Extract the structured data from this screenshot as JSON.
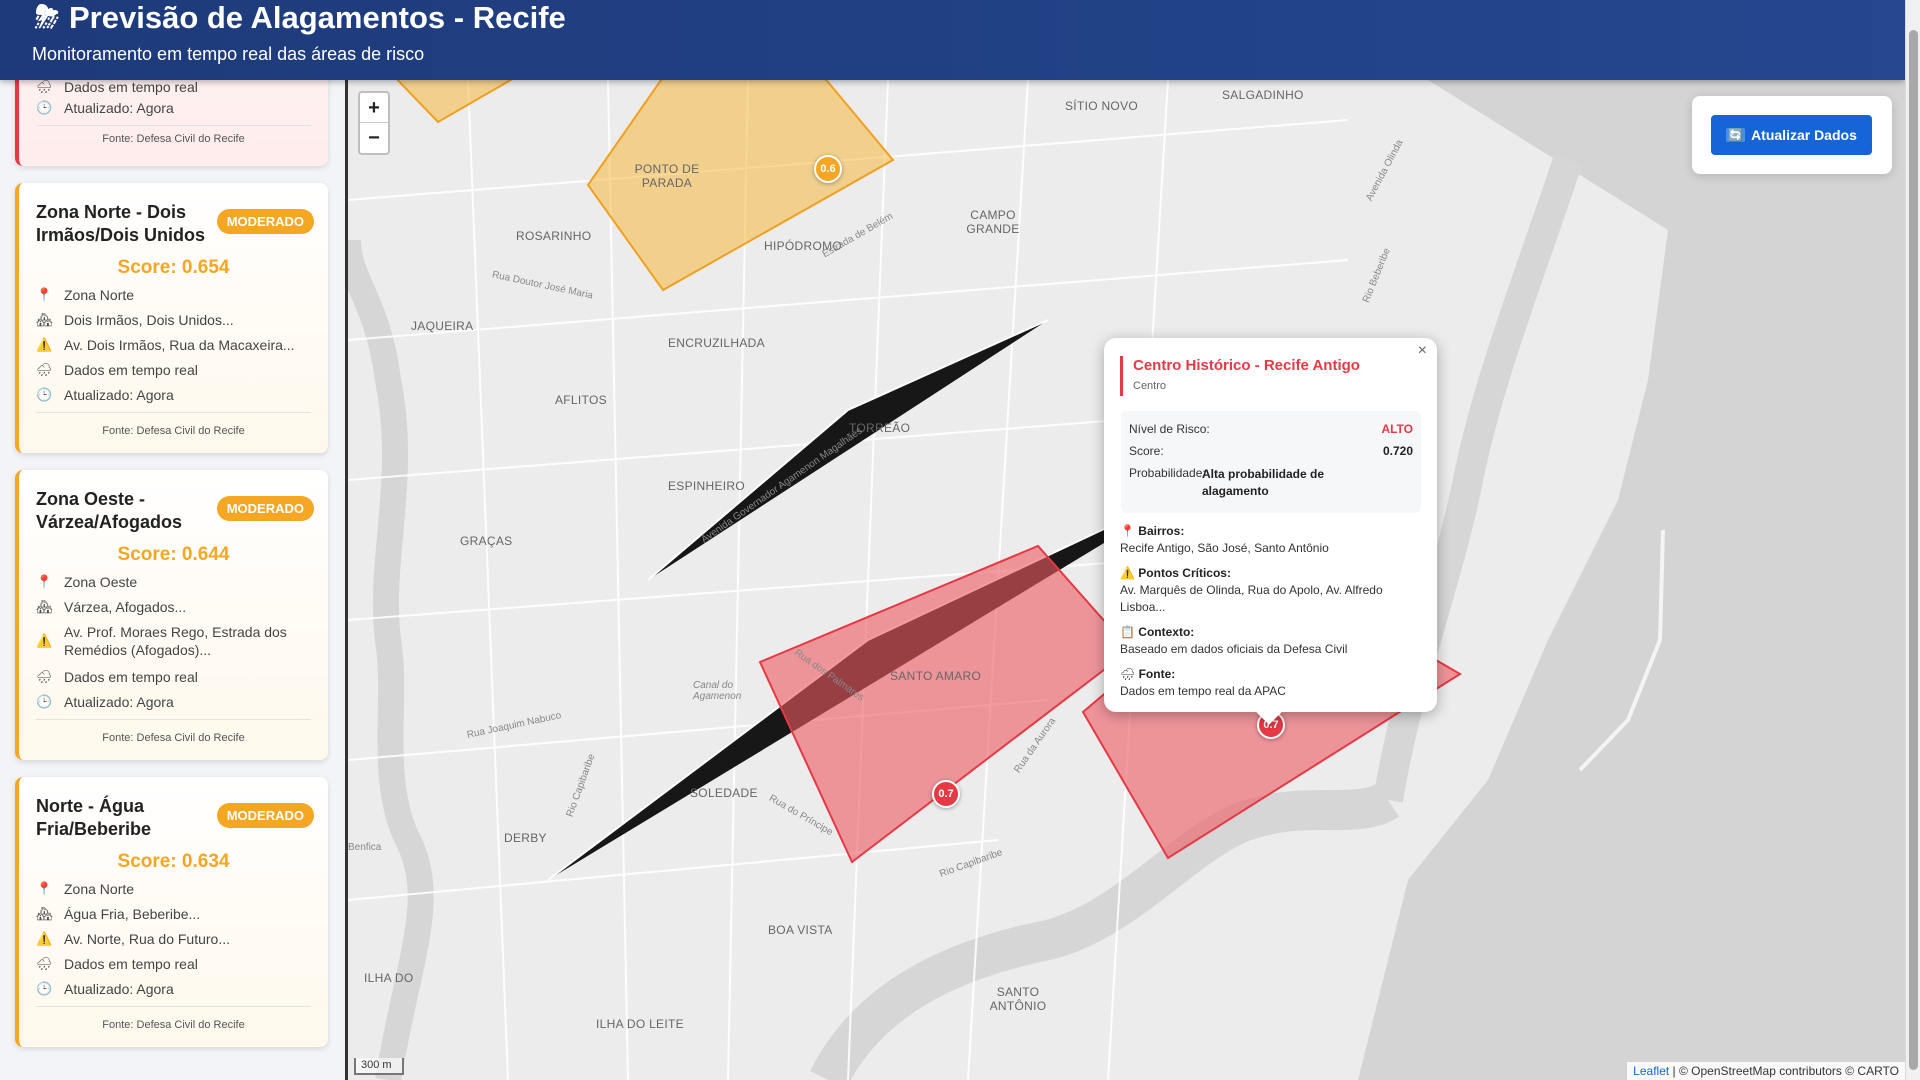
{
  "header": {
    "title": "Previsão de Alagamentos - Recife",
    "subtitle": "Monitoramento em tempo real das áreas de risco"
  },
  "sidebar": {
    "first_card_partial": {
      "data_label": "Dados em tempo real",
      "updated_label": "Atualizado: Agora",
      "source": "Fonte: Defesa Civil do Recife"
    },
    "cards": [
      {
        "name": "Zona Norte - Dois Irmãos/Dois Unidos",
        "badge": "MODERADO",
        "score": "Score: 0.654",
        "zone": "Zona Norte",
        "neighborhoods": "Dois Irmãos, Dois Unidos...",
        "critical": "Av. Dois Irmãos, Rua da Macaxeira...",
        "data_label": "Dados em tempo real",
        "updated_label": "Atualizado: Agora",
        "source": "Fonte: Defesa Civil do Recife"
      },
      {
        "name": "Zona Oeste - Várzea/Afogados",
        "badge": "MODERADO",
        "score": "Score: 0.644",
        "zone": "Zona Oeste",
        "neighborhoods": "Várzea, Afogados...",
        "critical": "Av. Prof. Moraes Rego, Estrada dos Remédios (Afogados)...",
        "data_label": "Dados em tempo real",
        "updated_label": "Atualizado: Agora",
        "source": "Fonte: Defesa Civil do Recife"
      },
      {
        "name": "Norte - Água Fria/Beberibe",
        "badge": "MODERADO",
        "score": "Score: 0.634",
        "zone": "Zona Norte",
        "neighborhoods": "Água Fria, Beberibe...",
        "critical": "Av. Norte, Rua do Futuro...",
        "data_label": "Dados em tempo real",
        "updated_label": "Atualizado: Agora",
        "source": "Fonte: Defesa Civil do Recife"
      }
    ]
  },
  "map": {
    "zoom_in": "+",
    "zoom_out": "−",
    "refresh_label": "Atualizar Dados",
    "markers": [
      "0.6",
      "0.7",
      "0.7"
    ],
    "places": {
      "salgadinho": "SALGADINHO",
      "sitio_novo": "SÍTIO NOVO",
      "ponto_de_parada": "PONTO DE PARADA",
      "campo_grande": "CAMPO GRANDE",
      "rosarinho": "ROSARINHO",
      "hipodromo": "HIPÓDROMO",
      "jaqueira": "JAQUEIRA",
      "encruzilhada": "ENCRUZILHADA",
      "aflitos": "AFLITOS",
      "torreao": "TORREÃO",
      "espinheiro": "ESPINHEIRO",
      "gracas": "GRAÇAS",
      "santo_amaro": "SANTO AMARO",
      "soledade": "SOLEDADE",
      "derby": "DERBY",
      "boa_vista": "BOA VISTA",
      "ilha_do": "ILHA DO",
      "ilha_do_leite": "ILHA DO LEITE",
      "santo_antonio": "SANTO ANTÔNIO"
    },
    "roads": {
      "olinda": "Avenida Olinda",
      "capibaribe": "Rio Capibaribe",
      "agamenon": "Avenida Governador Agamenon Magalhães",
      "joaquim_nabuco": "Rua Joaquim Nabuco",
      "belem": "Estrada de Belém",
      "canal": "Canal do Agamenon",
      "palmares": "Rua dos Palmares",
      "principe": "Rua do Príncipe",
      "aurora": "Rua da Aurora",
      "doutor_jose_maria": "Rua Doutor José Maria",
      "beberibe": "Rio Beberibe",
      "benfica": "Benfica"
    },
    "scale": "300 m",
    "attribution_link": "Leaflet",
    "attribution_rest": "| © OpenStreetMap contributors © CARTO"
  },
  "popup": {
    "close": "×",
    "title": "Centro Histórico - Recife Antigo",
    "zone": "Centro",
    "risk_label": "Nível de Risco:",
    "risk_value": "ALTO",
    "score_label": "Score:",
    "score_value": "0.720",
    "prob_label": "Probabilidade:",
    "prob_value": "Alta probabilidade de alagamento",
    "bairros_label": "Bairros:",
    "bairros_value": "Recife Antigo, São José, Santo Antônio",
    "pontos_label": "Pontos Críticos:",
    "pontos_value": "Av. Marquês de Olinda, Rua do Apolo, Av. Alfredo Lisboa...",
    "contexto_label": "Contexto:",
    "contexto_value": "Baseado em dados oficiais da Defesa Civil",
    "fonte_label": "Fonte:",
    "fonte_value": "Dados em tempo real da APAC"
  },
  "colors": {
    "header": "#1e3a7a",
    "moderate": "#f5a623",
    "high": "#e53945",
    "button": "#1565d8"
  }
}
